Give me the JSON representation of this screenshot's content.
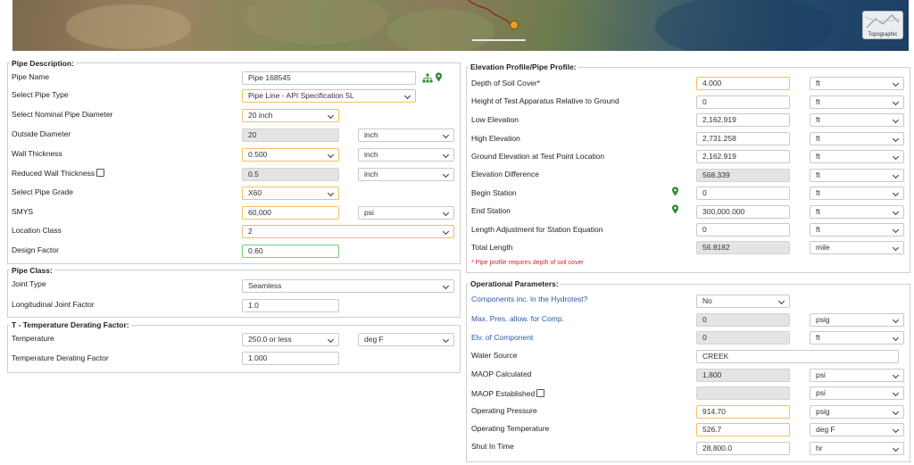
{
  "map": {
    "topo_label": "Topographic"
  },
  "pipe_description": {
    "title": "Pipe Description:",
    "pipe_name_label": "Pipe Name",
    "pipe_name": "Pipe 168545",
    "pipe_type_label": "Select Pipe Type",
    "pipe_type": "Pipe Line - API Specification 5L",
    "nominal_diameter_label": "Select Nominal Pipe Diameter",
    "nominal_diameter": "20 inch",
    "outside_diameter_label": "Outside Diameter",
    "outside_diameter": "20",
    "outside_diameter_unit": "inch",
    "wall_thickness_label": "Wall Thickness",
    "wall_thickness": "0.500",
    "wall_thickness_unit": "inch",
    "reduced_wall_label": "Reduced Wall Thickness",
    "reduced_wall": "0.5",
    "reduced_wall_unit": "inch",
    "pipe_grade_label": "Select Pipe Grade",
    "pipe_grade": "X60",
    "smys_label": "SMYS",
    "smys": "60,000",
    "smys_unit": "psi",
    "location_class_label": "Location Class",
    "location_class": "2",
    "design_factor_label": "Design Factor",
    "design_factor": "0.60"
  },
  "pipe_class": {
    "title": "Pipe Class:",
    "joint_type_label": "Joint Type",
    "joint_type": "Seamless",
    "joint_factor_label": "Longitudinal Joint Factor",
    "joint_factor": "1.0"
  },
  "temperature": {
    "title": "T - Temperature Derating Factor:",
    "temperature_label": "Temperature",
    "temperature": "250.0 or less",
    "temperature_unit": "deg F",
    "derating_label": "Temperature Derating Factor",
    "derating": "1.000"
  },
  "elevation": {
    "title": "Elevation Profile/Pipe Profile:",
    "soil_cover_label": "Depth of Soil Cover*",
    "soil_cover": "4.000",
    "soil_cover_unit": "ft",
    "test_height_label": "Height of Test Apparatus Relative to Ground",
    "test_height": "0",
    "test_height_unit": "ft",
    "low_elev_label": "Low Elevation",
    "low_elev": "2,162.919",
    "low_elev_unit": "ft",
    "high_elev_label": "High Elevation",
    "high_elev": "2,731.258",
    "high_elev_unit": "ft",
    "ground_elev_label": "Ground Elevation at Test Point Location",
    "ground_elev": "2,162.919",
    "ground_elev_unit": "ft",
    "elev_diff_label": "Elevation Difference",
    "elev_diff": "568.339",
    "elev_diff_unit": "ft",
    "begin_station_label": "Begin Station",
    "begin_station": "0",
    "begin_station_unit": "ft",
    "end_station_label": "End Station",
    "end_station": "300,000.000",
    "end_station_unit": "ft",
    "length_adj_label": "Length Adjustment for Station Equation",
    "length_adj": "0",
    "length_adj_unit": "ft",
    "total_length_label": "Total Length",
    "total_length": "56.8182",
    "total_length_unit": "mile",
    "note": "* Pipe profile requires depth of soil cover"
  },
  "operational": {
    "title": "Operational Parameters:",
    "components_label": "Components inc. in the Hydrotest?",
    "components": "No",
    "max_pres_label": "Max. Pres. allow. for Comp.",
    "max_pres": "0",
    "max_pres_unit": "psig",
    "elev_comp_label": "Elv. of Component",
    "elev_comp": "0",
    "elev_comp_unit": "ft",
    "water_source_label": "Water Source",
    "water_source": "CREEK",
    "maop_calc_label": "MAOP Calculated",
    "maop_calc": "1,800",
    "maop_calc_unit": "psi",
    "maop_est_label": "MAOP Established",
    "maop_est": "",
    "maop_est_unit": "psi",
    "op_pressure_label": "Operating Pressure",
    "op_pressure": "914.70",
    "op_pressure_unit": "psig",
    "op_temp_label": "Operating Temperature",
    "op_temp": "526.7",
    "op_temp_unit": "deg F",
    "shut_in_label": "Shut In Time",
    "shut_in": "28,800.0",
    "shut_in_unit": "hr"
  },
  "colors": {
    "highlight": "#f0c35a",
    "valid": "#6fcf7f",
    "link": "#2a5ba8",
    "warning": "#e0202a",
    "pin": "#2e8b3a"
  },
  "icons": {
    "location": "map-pin-icon",
    "network": "network-icon"
  }
}
